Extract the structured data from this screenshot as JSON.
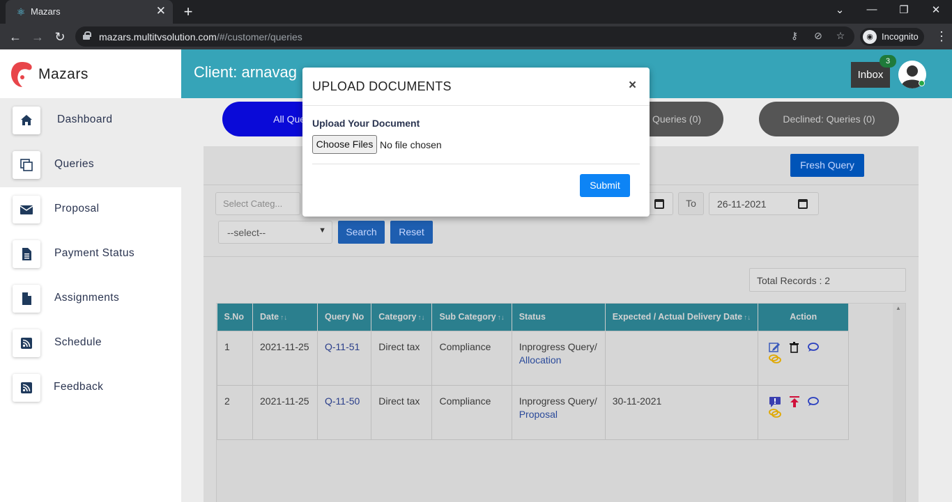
{
  "browser": {
    "tab_title": "Mazars",
    "url_domain": "mazars.multitvsolution.com",
    "url_path": "/#/customer/queries",
    "incognito_label": "Incognito"
  },
  "sidebar": {
    "brand": "Mazars",
    "items": [
      {
        "label": "Dashboard",
        "icon": "home-icon"
      },
      {
        "label": "Queries",
        "icon": "copy-icon"
      },
      {
        "label": "Proposal",
        "icon": "envelope-icon"
      },
      {
        "label": "Payment Status",
        "icon": "file-text-icon"
      },
      {
        "label": "Assignments",
        "icon": "file-icon"
      },
      {
        "label": "Schedule",
        "icon": "rss-icon"
      },
      {
        "label": "Feedback",
        "icon": "rss-icon"
      }
    ]
  },
  "header": {
    "client_label": "Client: arnavag",
    "inbox_label": "Inbox",
    "inbox_count": "3"
  },
  "tabs": {
    "all": "All Queri",
    "middle": "Queries (0)",
    "declined": "Declined: Queries (0)"
  },
  "toolbar": {
    "fresh_query": "Fresh Query",
    "category_placeholder": "Select Categ...",
    "to_label": "To",
    "to_date": "26-11-2021",
    "status_select": "--select--",
    "search": "Search",
    "reset": "Reset",
    "total_records": "Total Records : 2"
  },
  "table": {
    "headers": [
      "S.No",
      "Date",
      "Query No",
      "Category",
      "Sub Category",
      "Status",
      "Expected / Actual Delivery Date",
      "Action"
    ],
    "rows": [
      {
        "sno": "1",
        "date": "2021-11-25",
        "query_no": "Q-11-51",
        "category": "Direct tax",
        "sub_category": "Compliance",
        "status": "Inprogress Query/",
        "status_sub": "Allocation",
        "delivery": ""
      },
      {
        "sno": "2",
        "date": "2021-11-25",
        "query_no": "Q-11-50",
        "category": "Direct tax",
        "sub_category": "Compliance",
        "status": "Inprogress Query/",
        "status_sub": "Proposal",
        "delivery": "30-11-2021"
      }
    ]
  },
  "modal": {
    "title": "UPLOAD DOCUMENTS",
    "close": "×",
    "upload_label": "Upload Your Document",
    "choose_files": "Choose Files",
    "no_file": "No file chosen",
    "submit": "Submit"
  },
  "colors": {
    "header_teal": "#36a4b8",
    "table_header": "#2b7f8e",
    "submit_blue": "#0d84f5",
    "brand_red": "#e8454a"
  }
}
